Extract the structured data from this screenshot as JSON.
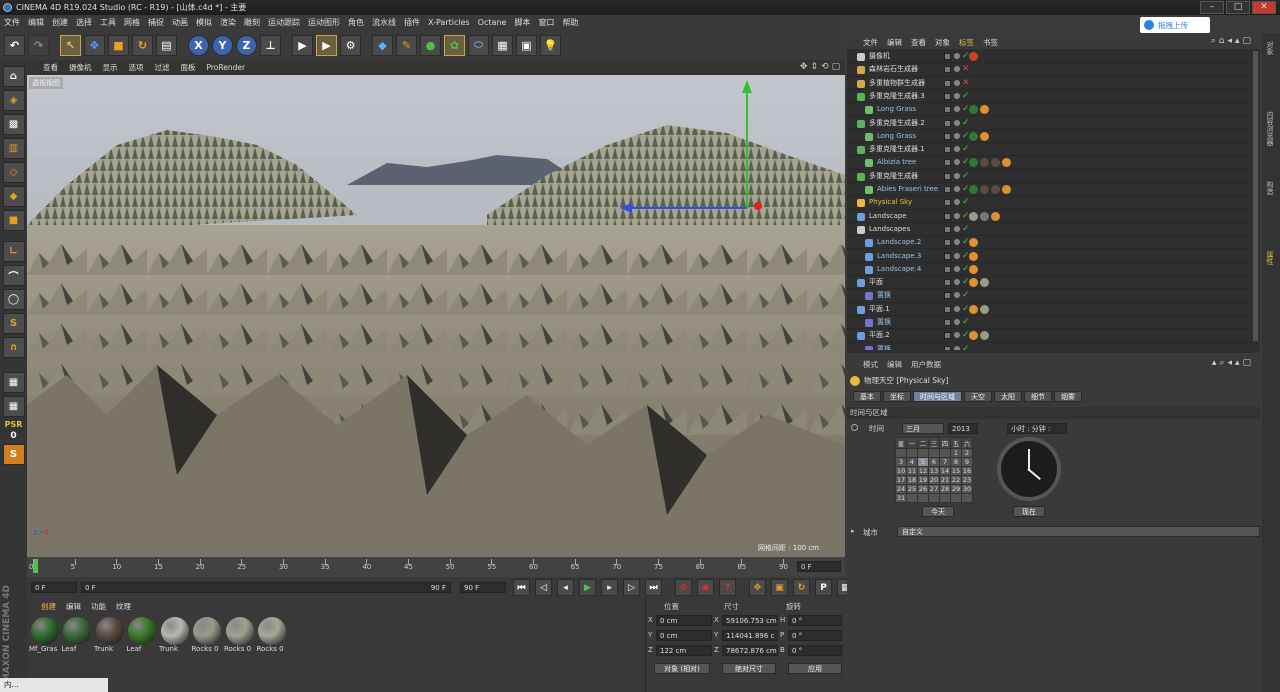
{
  "window": {
    "title": "CINEMA 4D R19.024 Studio (RC - R19) - [山体.c4d *] - 主要",
    "upload_button": "拖拽上传"
  },
  "menu": [
    "文件",
    "编辑",
    "创建",
    "选择",
    "工具",
    "网格",
    "捕捉",
    "动画",
    "模拟",
    "渲染",
    "雕刻",
    "运动跟踪",
    "运动图形",
    "角色",
    "流水线",
    "插件",
    "X-Particles",
    "Octane",
    "脚本",
    "窗口",
    "帮助"
  ],
  "viewport": {
    "menu": [
      "查看",
      "摄像机",
      "显示",
      "选项",
      "过滤",
      "面板",
      "ProRender"
    ],
    "label": "透视视图",
    "grid_label": "网格间距 : 100 cm"
  },
  "left_tools": {
    "psr_label": "PSR",
    "psr_value": "0"
  },
  "timeline": {
    "ticks": [
      "0",
      "5",
      "10",
      "15",
      "20",
      "25",
      "30",
      "35",
      "40",
      "45",
      "50",
      "55",
      "60",
      "65",
      "70",
      "75",
      "80",
      "85",
      "90"
    ],
    "right_field": "0 F"
  },
  "playback": {
    "start": "0 F",
    "current": "0 F",
    "range_end": "90 F",
    "end": "90 F"
  },
  "materials": {
    "menu": [
      "创建",
      "编辑",
      "功能",
      "纹理"
    ],
    "items": [
      {
        "name": "Mf_Gras",
        "color": "#2f6b2f"
      },
      {
        "name": "Leaf",
        "color": "#3b6a3b"
      },
      {
        "name": "Trunk",
        "color": "#5a4a40"
      },
      {
        "name": "Leaf",
        "color": "#3c7a2a"
      },
      {
        "name": "Trunk",
        "color": "#b8b8b0"
      },
      {
        "name": "Rocks 0",
        "color": "#9a9a8c"
      },
      {
        "name": "Rocks 0",
        "color": "#a2a290"
      },
      {
        "name": "Rocks 0",
        "color": "#a8a896"
      }
    ]
  },
  "coords": {
    "headers": [
      "位置",
      "尺寸",
      "旋转"
    ],
    "rows": [
      {
        "axis": "X",
        "pos": "0 cm",
        "size_axis": "X",
        "size": "59106.753 cm",
        "rot_axis": "H",
        "rot": "0 °"
      },
      {
        "axis": "Y",
        "pos": "0 cm",
        "size_axis": "Y",
        "size": "114041.896 c",
        "rot_axis": "P",
        "rot": "0 °"
      },
      {
        "axis": "Z",
        "pos": "122 cm",
        "size_axis": "Z",
        "size": "78672.876 cm",
        "rot_axis": "B",
        "rot": "0 °"
      }
    ],
    "mode": "对象 (相对)",
    "size_mode": "绝对尺寸",
    "apply": "应用"
  },
  "objects": {
    "menu": [
      "文件",
      "编辑",
      "查看",
      "对象",
      "标签",
      "书签"
    ],
    "rows": [
      {
        "name": "摄像机",
        "indent": 0,
        "icon": "#ccc",
        "tags": [
          "#d04020"
        ]
      },
      {
        "name": "森林岩石生成器",
        "indent": 0,
        "icon": "#d7a64a",
        "tags": []
      },
      {
        "name": "多重植物群生成器",
        "indent": 0,
        "icon": "#d7a64a",
        "tags": []
      },
      {
        "name": "多重克隆生成器.3",
        "indent": 0,
        "icon": "#5ab55a",
        "tags": []
      },
      {
        "name": "Long Grass",
        "indent": 1,
        "icon": "#6cc06c",
        "tags": [
          "#2f7a2f",
          "#e09030"
        ]
      },
      {
        "name": "多重克隆生成器.2",
        "indent": 0,
        "icon": "#5ab55a",
        "tags": []
      },
      {
        "name": "Long Grass",
        "indent": 1,
        "icon": "#6cc06c",
        "tags": [
          "#2f7a2f",
          "#e09030"
        ]
      },
      {
        "name": "多重克隆生成器.1",
        "indent": 0,
        "icon": "#5ab55a",
        "tags": []
      },
      {
        "name": "Albizia tree",
        "indent": 1,
        "icon": "#6cc06c",
        "tags": [
          "#2f7a2f",
          "#5a4a40",
          "#5a4a40",
          "#e09030"
        ]
      },
      {
        "name": "多重克隆生成器",
        "indent": 0,
        "icon": "#5ab55a",
        "tags": []
      },
      {
        "name": "Abies Fraseri tree",
        "indent": 1,
        "icon": "#6cc06c",
        "tags": [
          "#2f7a2f",
          "#5a4a40",
          "#5a4a40",
          "#e09030"
        ]
      },
      {
        "name": "Physical Sky",
        "indent": 0,
        "icon": "#e8b840",
        "tags": []
      },
      {
        "name": "Landscape",
        "indent": 0,
        "icon": "#6aa0e0",
        "tags": [
          "#9a9a8c",
          "#777",
          "#e09030"
        ]
      },
      {
        "name": "Landscapes",
        "indent": 0,
        "icon": "#ccc",
        "tags": []
      },
      {
        "name": "Landscape.2",
        "indent": 1,
        "icon": "#6aa0e0",
        "tags": [
          "#e09030"
        ]
      },
      {
        "name": "Landscape.3",
        "indent": 1,
        "icon": "#6aa0e0",
        "tags": [
          "#e09030"
        ]
      },
      {
        "name": "Landscape.4",
        "indent": 1,
        "icon": "#6aa0e0",
        "tags": [
          "#e09030"
        ]
      },
      {
        "name": "平面",
        "indent": 0,
        "icon": "#6aa0e0",
        "tags": [
          "#e09030",
          "#9a9a8c"
        ]
      },
      {
        "name": "置换",
        "indent": 1,
        "icon": "#7a70d0",
        "tags": []
      },
      {
        "name": "平面.1",
        "indent": 0,
        "icon": "#6aa0e0",
        "tags": [
          "#e09030",
          "#9a9a8c"
        ]
      },
      {
        "name": "置换",
        "indent": 1,
        "icon": "#7a70d0",
        "tags": []
      },
      {
        "name": "平面.2",
        "indent": 0,
        "icon": "#6aa0e0",
        "tags": [
          "#e09030",
          "#9a9a8c"
        ]
      },
      {
        "name": "置换",
        "indent": 1,
        "icon": "#7a70d0",
        "tags": []
      }
    ]
  },
  "attributes": {
    "menu": [
      "模式",
      "编辑",
      "用户数据"
    ],
    "object_title": "物理天空 [Physical Sky]",
    "tabs": [
      "基本",
      "坐标",
      "时间与区域",
      "天空",
      "太阳",
      "细节",
      "烟雾"
    ],
    "active_tab": "时间与区域",
    "section": "时间与区域",
    "time_label": "时间",
    "month": "三月",
    "year": "2013",
    "time_field": "小时 : 分钟 :",
    "weekdays": [
      "星",
      "一",
      "二",
      "三",
      "四",
      "五",
      "六"
    ],
    "calendar": [
      [
        "",
        "",
        "",
        "",
        "",
        "1",
        "2"
      ],
      [
        "3",
        "4",
        "5",
        "6",
        "7",
        "8",
        "9"
      ],
      [
        "10",
        "11",
        "12",
        "13",
        "14",
        "15",
        "16"
      ],
      [
        "17",
        "18",
        "19",
        "20",
        "21",
        "22",
        "23"
      ],
      [
        "24",
        "25",
        "26",
        "27",
        "28",
        "29",
        "30"
      ],
      [
        "31",
        "",
        "",
        "",
        "",
        "",
        ""
      ]
    ],
    "today_btn": "今天",
    "now_btn": "现在",
    "city_label": "城市",
    "city_value": "自定义"
  },
  "right_strip": [
    "对象",
    "内容浏览器",
    "构造",
    "属性"
  ],
  "taskbar_item": "内..."
}
